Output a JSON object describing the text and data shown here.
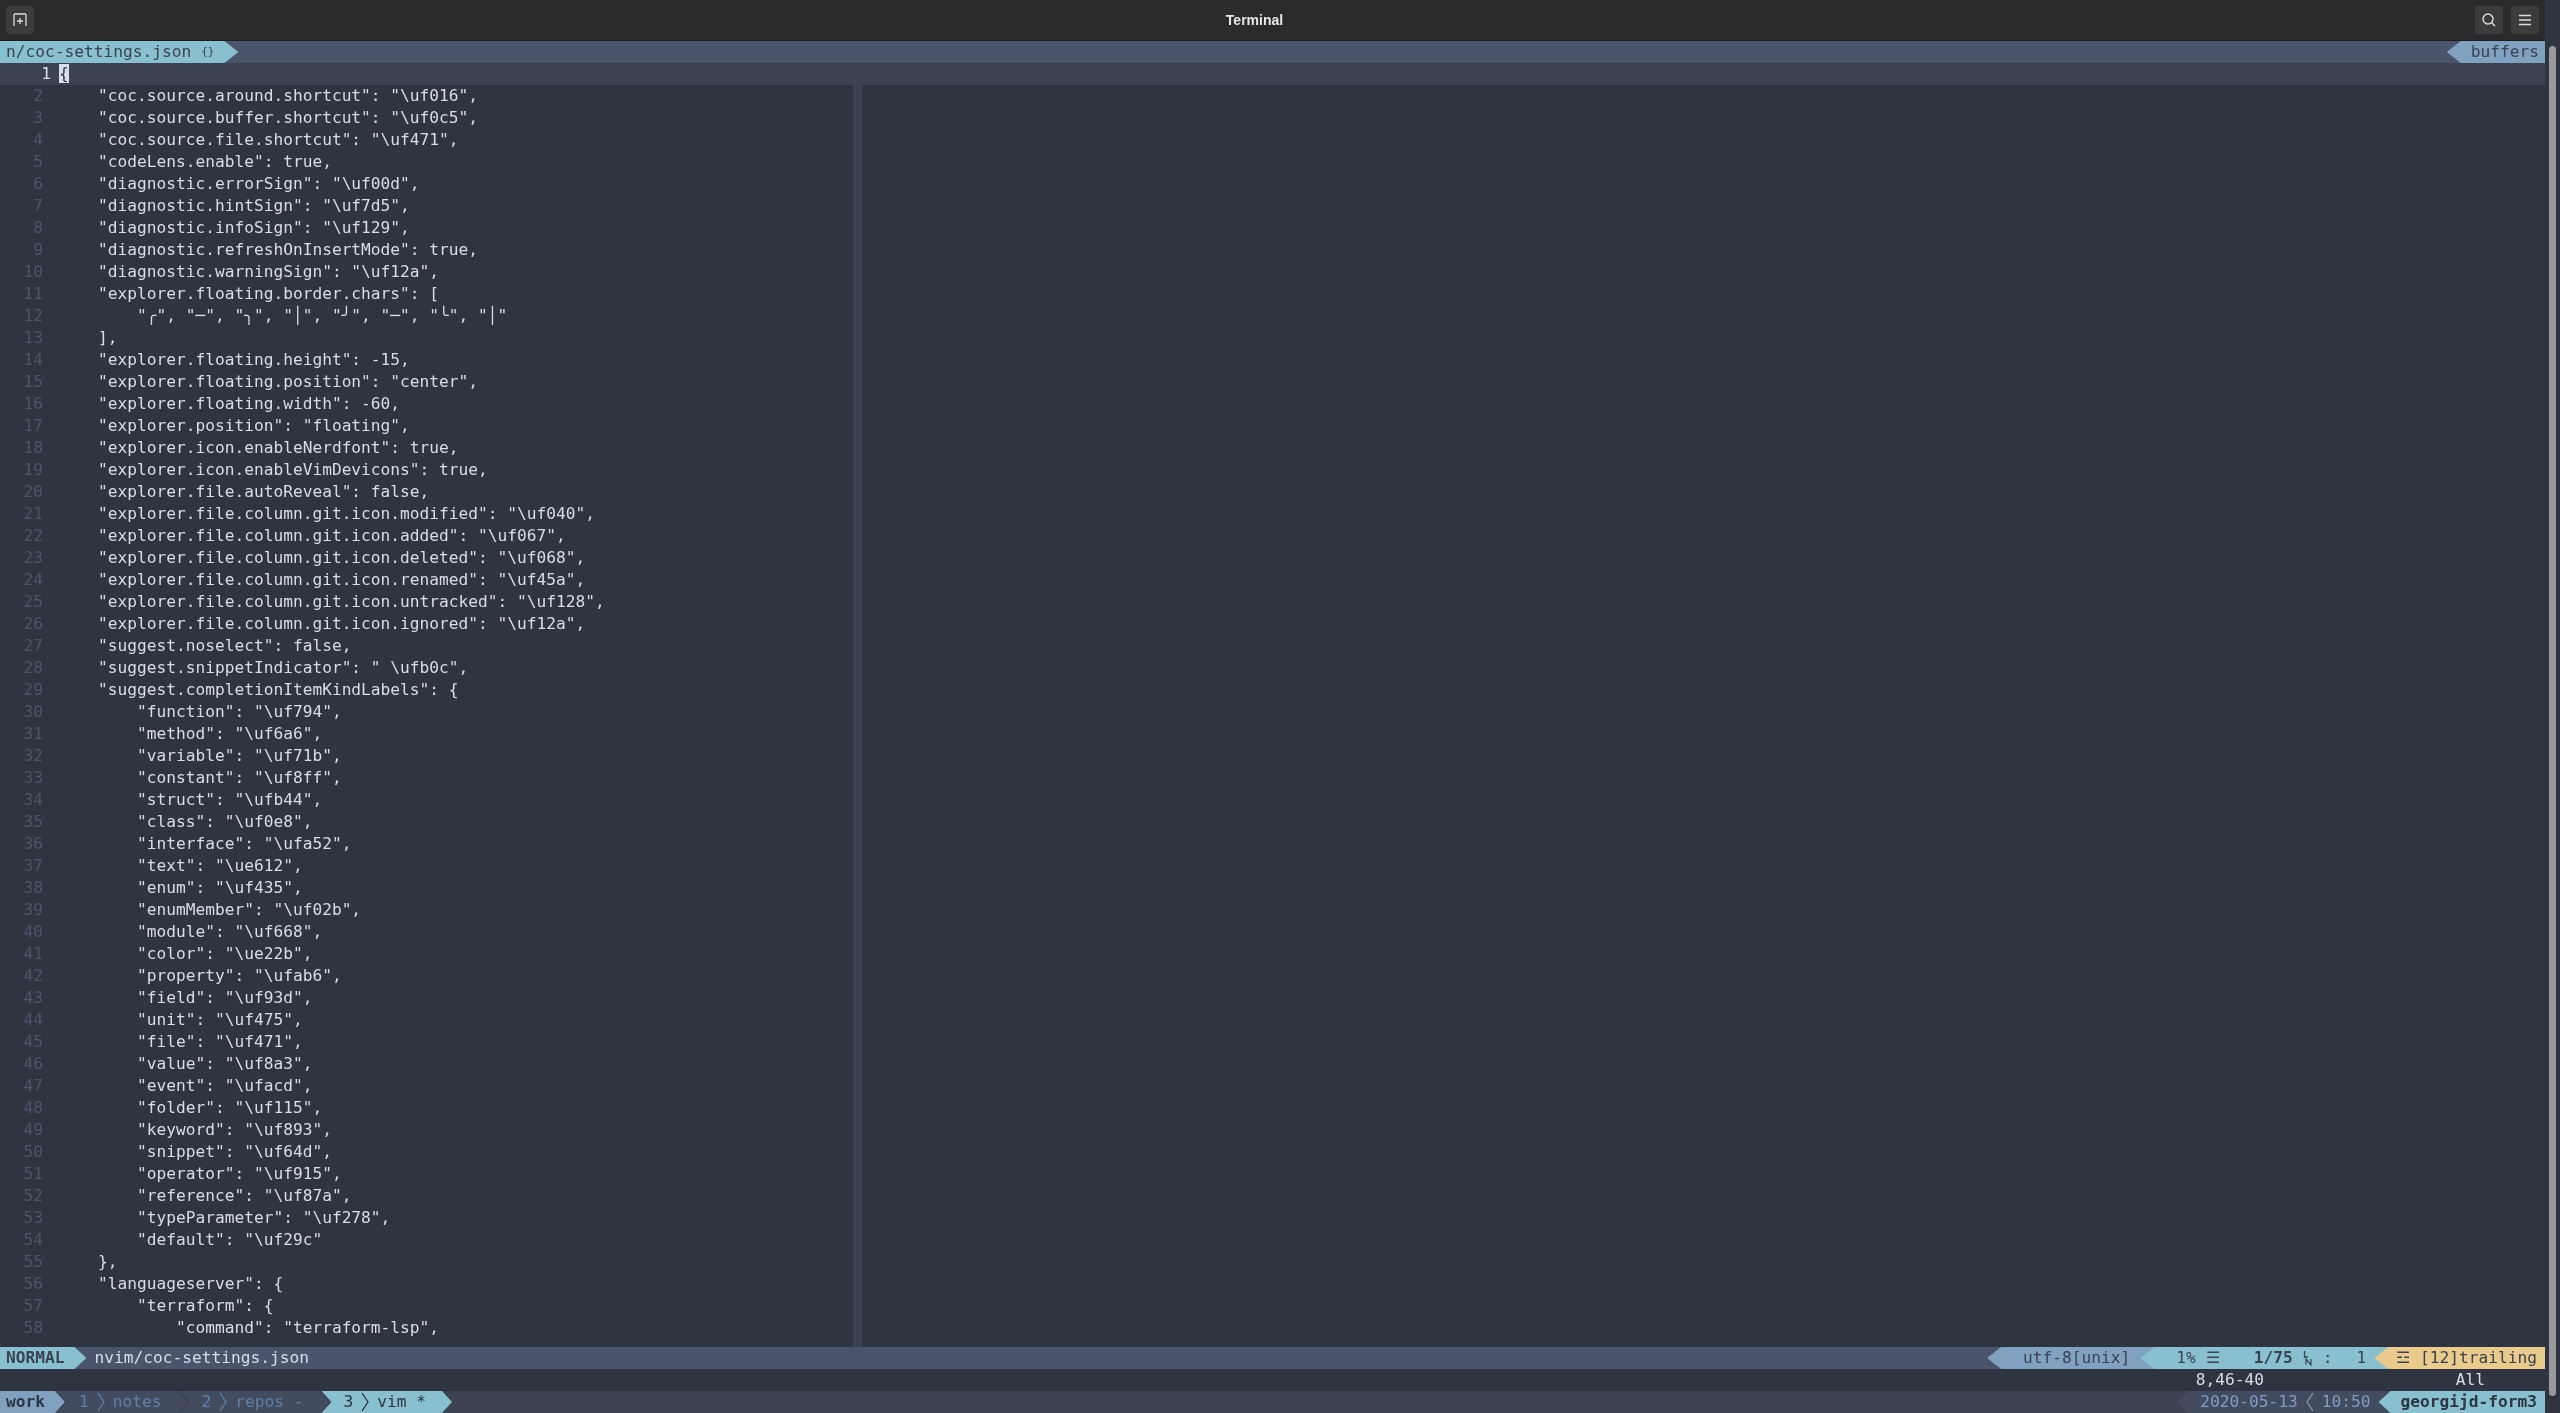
{
  "window": {
    "title": "Terminal"
  },
  "tabline": {
    "file_tab": "n/coc-settings.json",
    "file_icon": "{}",
    "right_label": "buffers"
  },
  "editor": {
    "lines": [
      {
        "number": "1",
        "text": "{",
        "current": true
      },
      {
        "number": "2",
        "text": "    \"coc.source.around.shortcut\": \"\\uf016\",",
        "current": false
      },
      {
        "number": "3",
        "text": "    \"coc.source.buffer.shortcut\": \"\\uf0c5\",",
        "current": false
      },
      {
        "number": "4",
        "text": "    \"coc.source.file.shortcut\": \"\\uf471\",",
        "current": false
      },
      {
        "number": "5",
        "text": "    \"codeLens.enable\": true,",
        "current": false
      },
      {
        "number": "6",
        "text": "    \"diagnostic.errorSign\": \"\\uf00d\",",
        "current": false
      },
      {
        "number": "7",
        "text": "    \"diagnostic.hintSign\": \"\\uf7d5\",",
        "current": false
      },
      {
        "number": "8",
        "text": "    \"diagnostic.infoSign\": \"\\uf129\",",
        "current": false
      },
      {
        "number": "9",
        "text": "    \"diagnostic.refreshOnInsertMode\": true,",
        "current": false
      },
      {
        "number": "10",
        "text": "    \"diagnostic.warningSign\": \"\\uf12a\",",
        "current": false
      },
      {
        "number": "11",
        "text": "    \"explorer.floating.border.chars\": [",
        "current": false
      },
      {
        "number": "12",
        "text": "        \"╭\", \"─\", \"╮\", \"│\", \"╯\", \"─\", \"╰\", \"│\"",
        "current": false
      },
      {
        "number": "13",
        "text": "    ],",
        "current": false
      },
      {
        "number": "14",
        "text": "    \"explorer.floating.height\": -15,",
        "current": false
      },
      {
        "number": "15",
        "text": "    \"explorer.floating.position\": \"center\",",
        "current": false
      },
      {
        "number": "16",
        "text": "    \"explorer.floating.width\": -60,",
        "current": false
      },
      {
        "number": "17",
        "text": "    \"explorer.position\": \"floating\",",
        "current": false
      },
      {
        "number": "18",
        "text": "    \"explorer.icon.enableNerdfont\": true,",
        "current": false
      },
      {
        "number": "19",
        "text": "    \"explorer.icon.enableVimDevicons\": true,",
        "current": false
      },
      {
        "number": "20",
        "text": "    \"explorer.file.autoReveal\": false,",
        "current": false
      },
      {
        "number": "21",
        "text": "    \"explorer.file.column.git.icon.modified\": \"\\uf040\",",
        "current": false
      },
      {
        "number": "22",
        "text": "    \"explorer.file.column.git.icon.added\": \"\\uf067\",",
        "current": false
      },
      {
        "number": "23",
        "text": "    \"explorer.file.column.git.icon.deleted\": \"\\uf068\",",
        "current": false
      },
      {
        "number": "24",
        "text": "    \"explorer.file.column.git.icon.renamed\": \"\\uf45a\",",
        "current": false
      },
      {
        "number": "25",
        "text": "    \"explorer.file.column.git.icon.untracked\": \"\\uf128\",",
        "current": false
      },
      {
        "number": "26",
        "text": "    \"explorer.file.column.git.icon.ignored\": \"\\uf12a\",",
        "current": false
      },
      {
        "number": "27",
        "text": "    \"suggest.noselect\": false,",
        "current": false
      },
      {
        "number": "28",
        "text": "    \"suggest.snippetIndicator\": \" \\ufb0c\",",
        "current": false
      },
      {
        "number": "29",
        "text": "    \"suggest.completionItemKindLabels\": {",
        "current": false
      },
      {
        "number": "30",
        "text": "        \"function\": \"\\uf794\",",
        "current": false
      },
      {
        "number": "31",
        "text": "        \"method\": \"\\uf6a6\",",
        "current": false
      },
      {
        "number": "32",
        "text": "        \"variable\": \"\\uf71b\",",
        "current": false
      },
      {
        "number": "33",
        "text": "        \"constant\": \"\\uf8ff\",",
        "current": false
      },
      {
        "number": "34",
        "text": "        \"struct\": \"\\ufb44\",",
        "current": false
      },
      {
        "number": "35",
        "text": "        \"class\": \"\\uf0e8\",",
        "current": false
      },
      {
        "number": "36",
        "text": "        \"interface\": \"\\ufa52\",",
        "current": false
      },
      {
        "number": "37",
        "text": "        \"text\": \"\\ue612\",",
        "current": false
      },
      {
        "number": "38",
        "text": "        \"enum\": \"\\uf435\",",
        "current": false
      },
      {
        "number": "39",
        "text": "        \"enumMember\": \"\\uf02b\",",
        "current": false
      },
      {
        "number": "40",
        "text": "        \"module\": \"\\uf668\",",
        "current": false
      },
      {
        "number": "41",
        "text": "        \"color\": \"\\ue22b\",",
        "current": false
      },
      {
        "number": "42",
        "text": "        \"property\": \"\\ufab6\",",
        "current": false
      },
      {
        "number": "43",
        "text": "        \"field\": \"\\uf93d\",",
        "current": false
      },
      {
        "number": "44",
        "text": "        \"unit\": \"\\uf475\",",
        "current": false
      },
      {
        "number": "45",
        "text": "        \"file\": \"\\uf471\",",
        "current": false
      },
      {
        "number": "46",
        "text": "        \"value\": \"\\uf8a3\",",
        "current": false
      },
      {
        "number": "47",
        "text": "        \"event\": \"\\ufacd\",",
        "current": false
      },
      {
        "number": "48",
        "text": "        \"folder\": \"\\uf115\",",
        "current": false
      },
      {
        "number": "49",
        "text": "        \"keyword\": \"\\uf893\",",
        "current": false
      },
      {
        "number": "50",
        "text": "        \"snippet\": \"\\uf64d\",",
        "current": false
      },
      {
        "number": "51",
        "text": "        \"operator\": \"\\uf915\",",
        "current": false
      },
      {
        "number": "52",
        "text": "        \"reference\": \"\\uf87a\",",
        "current": false
      },
      {
        "number": "53",
        "text": "        \"typeParameter\": \"\\uf278\",",
        "current": false
      },
      {
        "number": "54",
        "text": "        \"default\": \"\\uf29c\"",
        "current": false
      },
      {
        "number": "55",
        "text": "    },",
        "current": false
      },
      {
        "number": "56",
        "text": "    \"languageserver\": {",
        "current": false
      },
      {
        "number": "57",
        "text": "        \"terraform\": {",
        "current": false
      },
      {
        "number": "58",
        "text": "            \"command\": \"terraform-lsp\",",
        "current": false
      }
    ]
  },
  "statusline": {
    "mode": "NORMAL",
    "file": "nvim/coc-settings.json",
    "encoding": "utf-8[unix]",
    "percent": "1%",
    "percent_icon": "☰",
    "position": "1/75",
    "column_sep": ":",
    "column": "1",
    "trailing_icon": "☲",
    "trailing": "[12]trailing"
  },
  "cmdline": {
    "ruler": "8,46-40",
    "scroll": "All"
  },
  "tmux": {
    "session": "work",
    "windows": [
      {
        "index": "1",
        "name": "notes",
        "selected": false
      },
      {
        "index": "2",
        "name": "repos -",
        "selected": false
      },
      {
        "index": "3",
        "name": "vim *",
        "selected": true
      }
    ],
    "date": "2020-05-13",
    "time": "10:50",
    "host": "georgijd-form3"
  }
}
